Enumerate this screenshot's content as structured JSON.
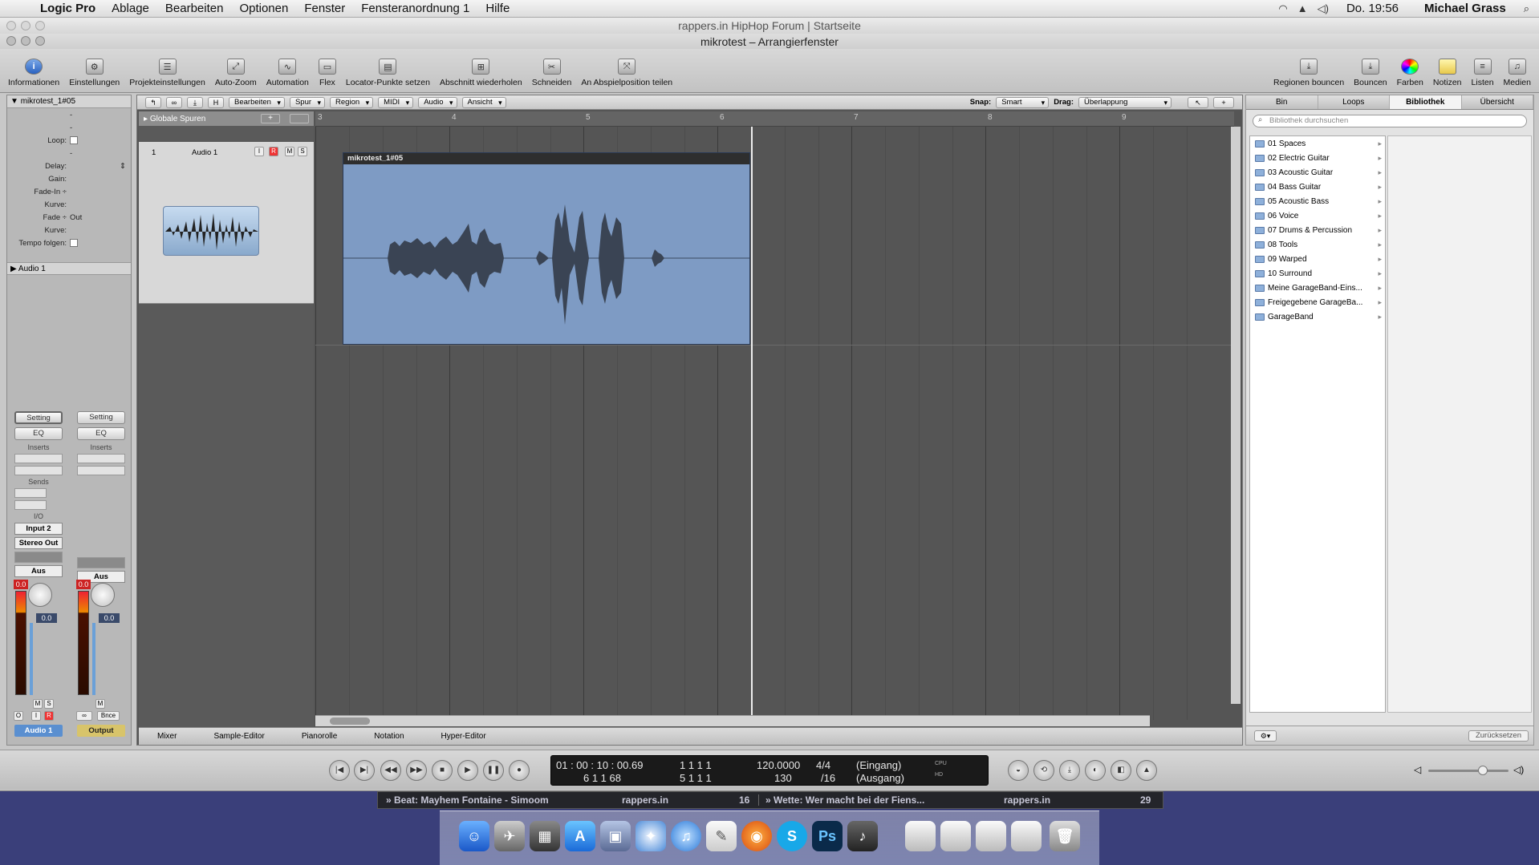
{
  "menubar": {
    "app": "Logic Pro",
    "items": [
      "Ablage",
      "Bearbeiten",
      "Optionen",
      "Fenster",
      "Fensteranordnung 1",
      "Hilfe"
    ],
    "clock": "Do. 19:56",
    "user": "Michael Grass"
  },
  "browser_title": "rappers.in HipHop Forum | Startseite",
  "window_title": "mikrotest – Arrangierfenster",
  "toolbar": {
    "left": [
      "Informationen",
      "Einstellungen",
      "Projekteinstellungen",
      "Auto-Zoom",
      "Automation",
      "Flex",
      "Locator-Punkte setzen",
      "Abschnitt wiederholen",
      "Schneiden",
      "An Abspielposition teilen"
    ],
    "right": [
      "Regionen bouncen",
      "Bouncen",
      "Farben",
      "Notizen",
      "Listen",
      "Medien"
    ]
  },
  "inspector": {
    "region_name": "mikrotest_1#05",
    "dash1": "-",
    "dash2": "-",
    "loop_label": "Loop:",
    "dash3": "-",
    "delay_label": "Delay:",
    "gain_label": "Gain:",
    "fadein_label": "Fade-In ÷",
    "kurve1_label": "Kurve:",
    "fade_label": "Fade ÷",
    "fade_value": "Out",
    "kurve2_label": "Kurve:",
    "tempo_label": "Tempo folgen:",
    "track_section": "Audio 1"
  },
  "strip1": {
    "setting": "Setting",
    "eq": "EQ",
    "inserts": "Inserts",
    "sends": "Sends",
    "io": "I/O",
    "input": "Input 2",
    "output": "Stereo Out",
    "auto": "Aus",
    "peak": "0.0",
    "fader": "0.0",
    "m": "M",
    "s": "S",
    "o": "O",
    "i": "I",
    "r": "R",
    "name": "Audio 1",
    "name_color": "#5a8fd0"
  },
  "strip2": {
    "setting": "Setting",
    "eq": "EQ",
    "inserts": "Inserts",
    "auto": "Aus",
    "peak": "0.0",
    "fader": "0.0",
    "m": "M",
    "link": "∞",
    "bnce": "Bnce",
    "name": "Output",
    "name_color": "#d8c46a"
  },
  "arrange_toolbar": {
    "edit": "Bearbeiten",
    "track": "Spur",
    "region": "Region",
    "midi": "MIDI",
    "audio": "Audio",
    "view": "Ansicht",
    "h_btn": "H",
    "snap_label": "Snap:",
    "snap_value": "Smart",
    "drag_label": "Drag:",
    "drag_value": "Überlappung"
  },
  "tracks": {
    "global": "Globale Spuren",
    "track1_num": "1",
    "track1_name": "Audio 1",
    "btn_i": "I",
    "btn_r": "R",
    "btn_m": "M",
    "btn_s": "S"
  },
  "ruler": [
    "3",
    "4",
    "5",
    "6",
    "7",
    "8",
    "9"
  ],
  "region_label": "mikrotest_1#05",
  "bottom_tabs": [
    "Mixer",
    "Sample-Editor",
    "Pianorolle",
    "Notation",
    "Hyper-Editor"
  ],
  "library": {
    "tabs": [
      "Bin",
      "Loops",
      "Bibliothek",
      "Übersicht"
    ],
    "active_tab": "Bibliothek",
    "search_placeholder": "Bibliothek durchsuchen",
    "items": [
      "01 Spaces",
      "02 Electric Guitar",
      "03 Acoustic Guitar",
      "04 Bass Guitar",
      "05 Acoustic Bass",
      "06 Voice",
      "07 Drums & Percussion",
      "08 Tools",
      "09 Warped",
      "10 Surround",
      "Meine GarageBand-Eins...",
      "Freigegebene GarageBa...",
      "GarageBand"
    ],
    "reset": "Zurücksetzen"
  },
  "transport": {
    "smpte": "01 : 00 : 10 : 00.69",
    "bars": "6    1    1    68",
    "pos_top": "1    1    1      1",
    "pos_bottom": "5    1    1      1",
    "tempo_top": "120.0000",
    "tempo_bottom": "130",
    "sig_top": "4/4",
    "sig_bottom": "/16",
    "in": "(Eingang)",
    "out": "(Ausgang)",
    "cpu": "CPU",
    "hd": "HD"
  },
  "ticker": {
    "item1": "» Beat: Mayhem Fontaine - Simoom",
    "site1": "rappers.in",
    "count1": "16",
    "item2": "» Wette: Wer macht bei der Fiens...",
    "site2": "rappers.in",
    "count2": "29"
  }
}
